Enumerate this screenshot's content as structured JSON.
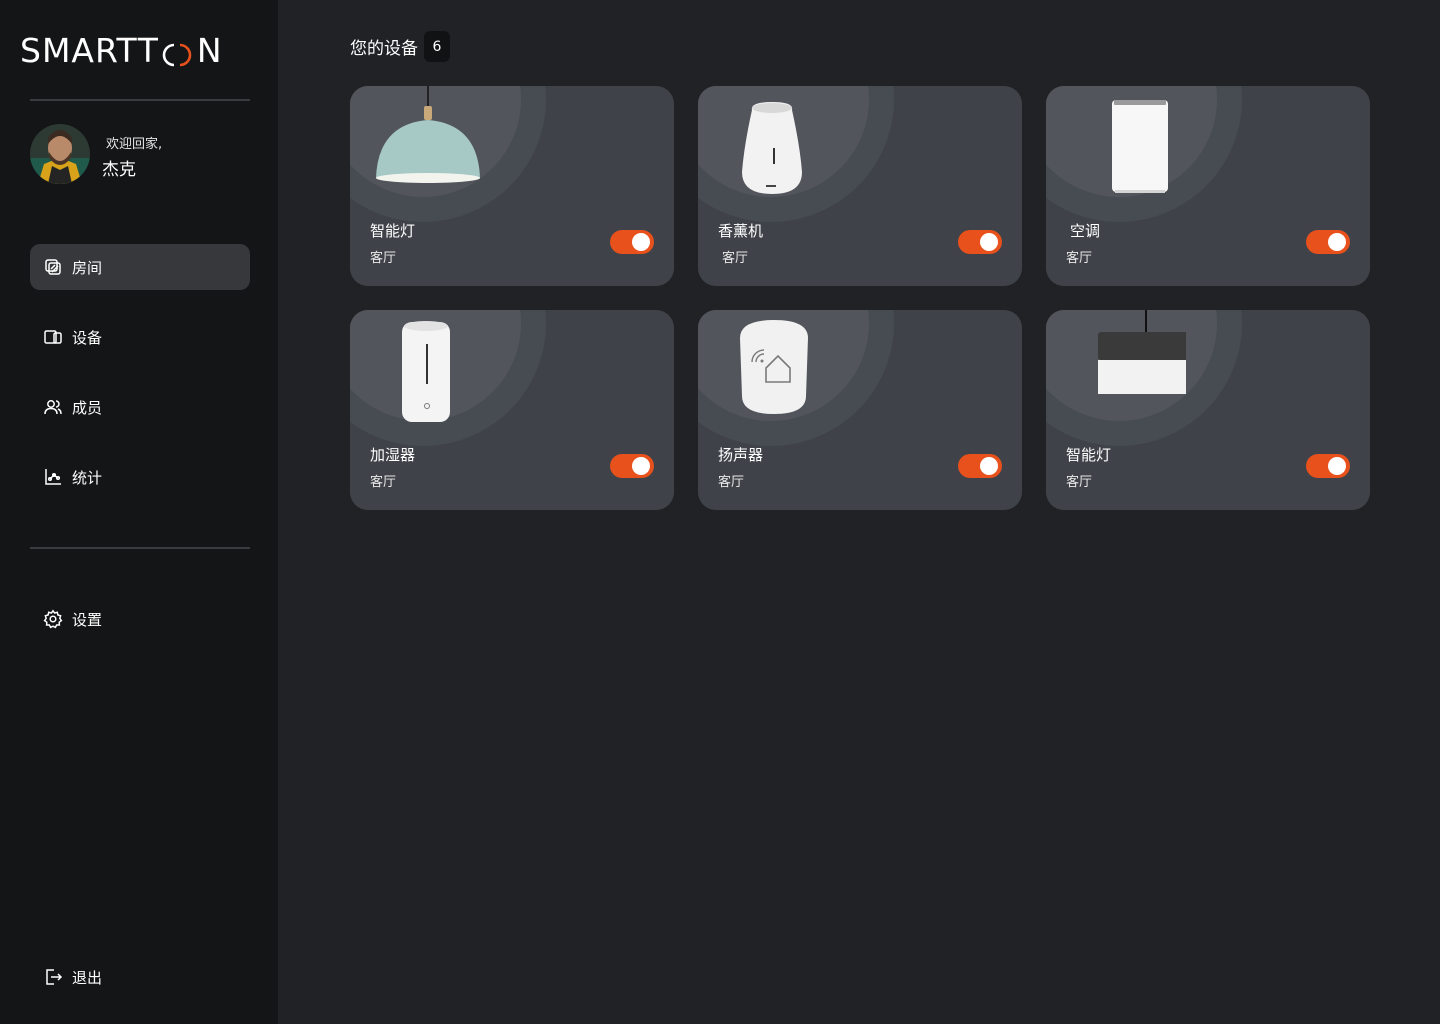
{
  "brand": {
    "logo_left": "SMART",
    "logo_right": "N",
    "accent": "#e8501c"
  },
  "profile": {
    "greeting": "欢迎回家,",
    "name": "杰克"
  },
  "nav": {
    "items": [
      {
        "label": "房间",
        "icon": "rooms-icon",
        "active": true
      },
      {
        "label": "设备",
        "icon": "devices-icon",
        "active": false
      },
      {
        "label": "成员",
        "icon": "members-icon",
        "active": false
      },
      {
        "label": "统计",
        "icon": "stats-icon",
        "active": false
      }
    ],
    "settings": {
      "label": "设置",
      "icon": "gear-icon"
    },
    "logout": {
      "label": "退出",
      "icon": "logout-icon"
    }
  },
  "main": {
    "title": "您的设备",
    "count": "6",
    "devices": [
      {
        "name": "智能灯",
        "room": "客厅",
        "on": true,
        "image": "pendant-lamp"
      },
      {
        "name": "香薰机",
        "room": "客厅",
        "on": true,
        "image": "aroma-diffuser"
      },
      {
        "name": "空调",
        "room": "客厅",
        "on": true,
        "image": "air-conditioner"
      },
      {
        "name": "加湿器",
        "room": "客厅",
        "on": true,
        "image": "humidifier"
      },
      {
        "name": "扬声器",
        "room": "客厅",
        "on": true,
        "image": "smart-speaker"
      },
      {
        "name": "智能灯",
        "room": "客厅",
        "on": true,
        "image": "cylinder-lamp"
      }
    ]
  }
}
